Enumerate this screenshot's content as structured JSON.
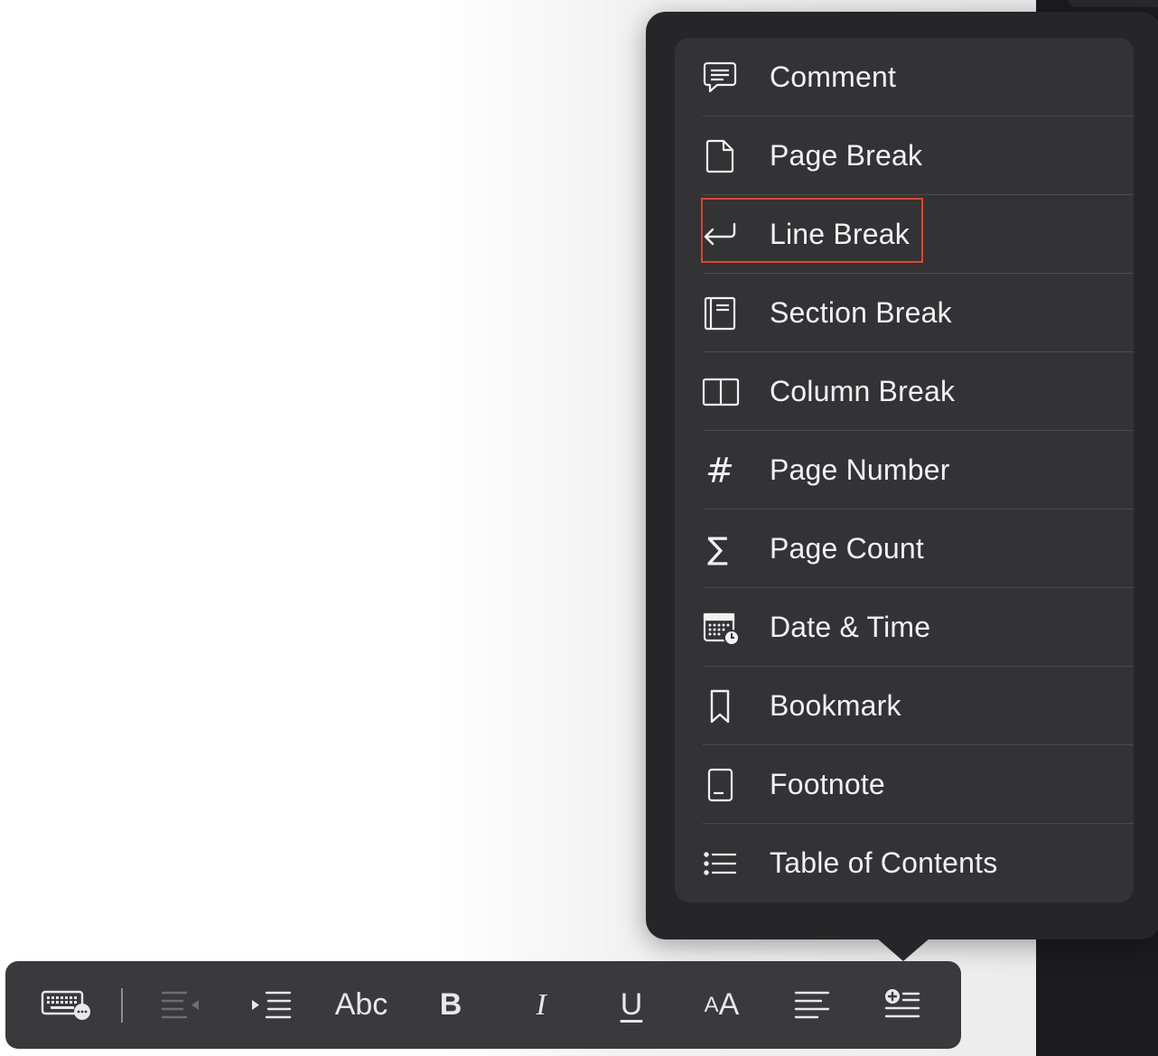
{
  "menu": {
    "items": [
      {
        "label": "Comment",
        "icon": "comment-icon"
      },
      {
        "label": "Page Break",
        "icon": "page-break-icon"
      },
      {
        "label": "Line Break",
        "icon": "line-break-icon"
      },
      {
        "label": "Section Break",
        "icon": "section-break-icon"
      },
      {
        "label": "Column Break",
        "icon": "column-break-icon"
      },
      {
        "label": "Page Number",
        "icon": "hash-icon"
      },
      {
        "label": "Page Count",
        "icon": "sigma-icon"
      },
      {
        "label": "Date & Time",
        "icon": "calendar-clock-icon"
      },
      {
        "label": "Bookmark",
        "icon": "bookmark-icon"
      },
      {
        "label": "Footnote",
        "icon": "footnote-icon"
      },
      {
        "label": "Table of Contents",
        "icon": "list-icon"
      }
    ],
    "highlighted_item": "Line Break",
    "highlight_color": "#e0442a"
  },
  "glyphs": {
    "hash": "#",
    "sigma": "∑"
  },
  "toolbar": {
    "style_label": "Abc",
    "bold_label": "B",
    "italic_label": "I",
    "underline_label": "U",
    "font_size_small": "A",
    "font_size_large": "A"
  },
  "colors": {
    "popover_bg": "#262628",
    "menu_bg": "#333335",
    "toolbar_bg": "#3a3a3c",
    "text": "#f2f2f2"
  }
}
